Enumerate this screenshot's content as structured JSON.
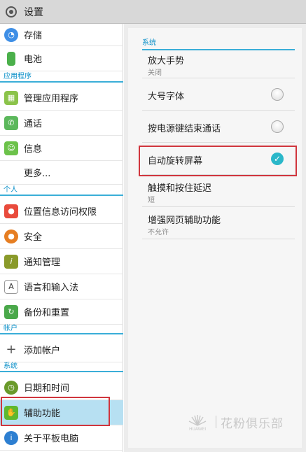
{
  "header": {
    "title": "设置",
    "icon": "settings-icon"
  },
  "sidebar": {
    "items": [
      {
        "label": "存储",
        "icon": "storage-pie-icon",
        "color": "#3f8fe6"
      },
      {
        "label": "电池",
        "icon": "battery-icon",
        "color": "#4bb04b"
      },
      {
        "section": "应用程序"
      },
      {
        "label": "管理应用程序",
        "icon": "apps-grid-icon",
        "color": "#8bc34a"
      },
      {
        "label": "通话",
        "icon": "phone-icon",
        "color": "#5cb85c"
      },
      {
        "label": "信息",
        "icon": "message-icon",
        "color": "#6cc24a"
      },
      {
        "label": "更多...",
        "icon": ""
      },
      {
        "section": "个人"
      },
      {
        "label": "位置信息访问权限",
        "icon": "location-icon",
        "color": "#e94b3c"
      },
      {
        "label": "安全",
        "icon": "lock-icon",
        "color": "#e67e22"
      },
      {
        "label": "通知管理",
        "icon": "notification-icon",
        "color": "#8a9a2a"
      },
      {
        "label": "语言和输入法",
        "icon": "keyboard-icon",
        "color": "#777777"
      },
      {
        "label": "备份和重置",
        "icon": "backup-icon",
        "color": "#4aa84a"
      },
      {
        "section": "帐户"
      },
      {
        "label": "添加帐户",
        "icon": "plus-icon",
        "color": "#666666"
      },
      {
        "section": "系统"
      },
      {
        "label": "日期和时间",
        "icon": "clock-icon",
        "color": "#6a9a2a"
      },
      {
        "label": "辅助功能",
        "icon": "hand-icon",
        "color": "#5fb82e",
        "selected": true
      },
      {
        "label": "关于平板电脑",
        "icon": "info-icon",
        "color": "#2d7fd1"
      }
    ]
  },
  "panel": {
    "section": "系统",
    "rows": [
      {
        "title": "放大手势",
        "subtitle": "关闭",
        "control": "none"
      },
      {
        "title": "大号字体",
        "subtitle": "",
        "control": "radio-unchecked"
      },
      {
        "title": "按电源键结束通话",
        "subtitle": "",
        "control": "radio-unchecked"
      },
      {
        "title": "自动旋转屏幕",
        "subtitle": "",
        "control": "checked"
      },
      {
        "title": "触摸和按住延迟",
        "subtitle": "短",
        "control": "none"
      },
      {
        "title": "增强网页辅助功能",
        "subtitle": "不允许",
        "control": "none"
      }
    ]
  },
  "watermark": {
    "text": "花粉俱乐部",
    "brand": "HUAWEI"
  },
  "colors": {
    "accent": "#3aaed8",
    "selected_bg": "#b7e0f2",
    "highlight_box": "#d0353d",
    "check": "#2ab7c9"
  }
}
